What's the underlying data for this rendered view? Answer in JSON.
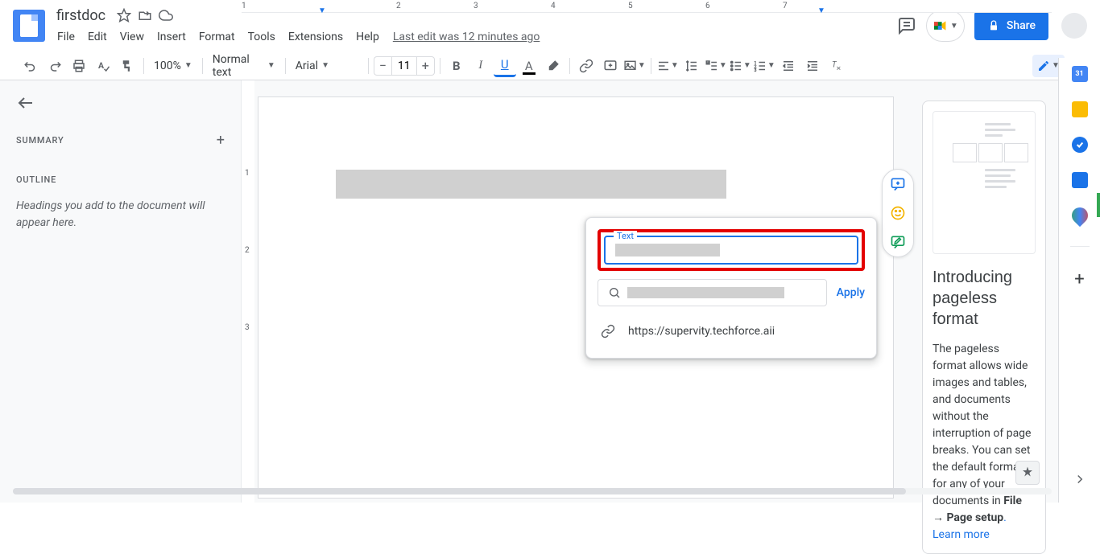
{
  "header": {
    "title": "firstdoc",
    "lastEdit": "Last edit was 12 minutes ago",
    "share": "Share"
  },
  "menu": {
    "file": "File",
    "edit": "Edit",
    "view": "View",
    "insert": "Insert",
    "format": "Format",
    "tools": "Tools",
    "extensions": "Extensions",
    "help": "Help"
  },
  "toolbar": {
    "zoom": "100%",
    "style": "Normal text",
    "font": "Arial",
    "fontSize": "11"
  },
  "outline": {
    "summary": "SUMMARY",
    "outline": "OUTLINE",
    "hint": "Headings you add to the document will appear here."
  },
  "linkDialog": {
    "textLabel": "Text",
    "apply": "Apply",
    "suggestion": "https://supervity.techforce.aii"
  },
  "infoPanel": {
    "title": "Introducing pageless format",
    "body": "The pageless format allows wide images and tables, and documents without the interruption of page breaks. You can set the default format for any of your documents in ",
    "fileSetup": "File → Page setup",
    "learn": ". Learn more"
  },
  "ruler": {
    "m1": "1",
    "m2": "2",
    "m3": "3",
    "m4": "4",
    "m5": "5",
    "m6": "6",
    "m7": "7"
  },
  "vruler": {
    "m1": "1",
    "m2": "2",
    "m3": "3"
  }
}
